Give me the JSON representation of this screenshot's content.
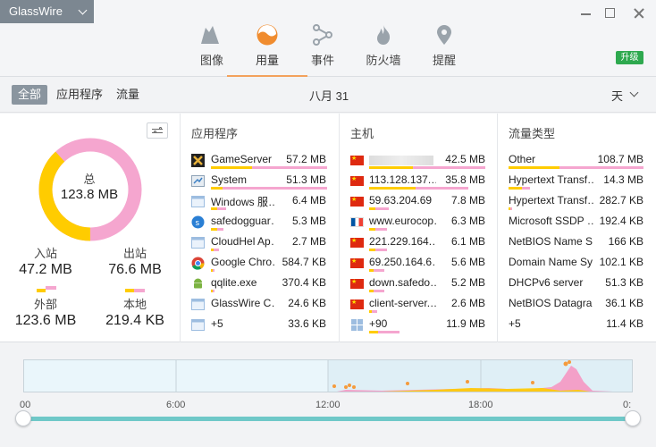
{
  "window": {
    "app_name": "GlassWire"
  },
  "nav": {
    "tabs": [
      {
        "label": "图像"
      },
      {
        "label": "用量"
      },
      {
        "label": "事件"
      },
      {
        "label": "防火墙"
      },
      {
        "label": "提醒"
      }
    ],
    "upgrade_label": "升级"
  },
  "filter": {
    "all": "全部",
    "apps": "应用程序",
    "traffic": "流量",
    "date": "八月 31",
    "period": "天"
  },
  "summary": {
    "total_label": "总",
    "total_value": "123.8 MB",
    "incoming_label": "入站",
    "incoming_value": "47.2 MB",
    "outgoing_label": "出站",
    "outgoing_value": "76.6 MB",
    "external_label": "外部",
    "external_value": "123.6 MB",
    "local_label": "本地",
    "local_value": "219.4 KB",
    "incoming_fraction": 0.381,
    "colors": {
      "incoming": "#ffcc00",
      "outgoing": "#f5a6cf"
    }
  },
  "apps": {
    "title": "应用程序",
    "rows": [
      {
        "name": "GameServer",
        "value": "57.2 MB",
        "icon": "gameserver-icon",
        "in": 0.35,
        "out": 0.65
      },
      {
        "name": "System",
        "value": "51.3 MB",
        "icon": "system-icon",
        "in": 0.1,
        "out": 0.9
      },
      {
        "name": "Windows 服…",
        "value": "6.4 MB",
        "icon": "window-icon",
        "in": 0.05,
        "out": 0.08
      },
      {
        "name": "safedogguar…",
        "value": "5.3 MB",
        "icon": "safedog-icon",
        "in": 0.05,
        "out": 0.06
      },
      {
        "name": "CloudHel Ap…",
        "value": "2.7 MB",
        "icon": "window-icon",
        "in": 0.02,
        "out": 0.05
      },
      {
        "name": "Google Chro…",
        "value": "584.7 KB",
        "icon": "chrome-icon",
        "in": 0.01,
        "out": 0.01
      },
      {
        "name": "qqlite.exe",
        "value": "370.4 KB",
        "icon": "android-icon",
        "in": 0.01,
        "out": 0.01
      },
      {
        "name": "GlassWire C…",
        "value": "24.6 KB",
        "icon": "window-icon",
        "in": 0.0,
        "out": 0.0
      },
      {
        "name": "+5",
        "value": "33.6 KB",
        "icon": "window-icon",
        "in": 0.0,
        "out": 0.0
      }
    ]
  },
  "hosts": {
    "title": "主机",
    "rows": [
      {
        "name": "",
        "value": "42.5 MB",
        "flag": "cn",
        "in": 0.38,
        "out": 0.62
      },
      {
        "name": "113.128.137.…",
        "value": "35.8 MB",
        "flag": "cn",
        "in": 0.4,
        "out": 0.45
      },
      {
        "name": "59.63.204.69",
        "value": "7.8 MB",
        "flag": "cn",
        "in": 0.05,
        "out": 0.12
      },
      {
        "name": "www.eurocop…",
        "value": "6.3 MB",
        "flag": "fr",
        "in": 0.05,
        "out": 0.1
      },
      {
        "name": "221.229.164.…",
        "value": "6.1 MB",
        "flag": "cn",
        "in": 0.05,
        "out": 0.1
      },
      {
        "name": "69.250.164.6…",
        "value": "5.6 MB",
        "flag": "cn",
        "in": 0.04,
        "out": 0.09
      },
      {
        "name": "down.safedo…",
        "value": "5.2 MB",
        "flag": "cn",
        "in": 0.04,
        "out": 0.09
      },
      {
        "name": "client-server.…",
        "value": "2.6 MB",
        "flag": "cn",
        "in": 0.02,
        "out": 0.05
      },
      {
        "name": "+90",
        "value": "11.9 MB",
        "flag": "grid",
        "in": 0.08,
        "out": 0.18
      }
    ]
  },
  "traffic_types": {
    "title": "流量类型",
    "rows": [
      {
        "name": "Other",
        "value": "108.7 MB",
        "in": 0.38,
        "out": 0.62
      },
      {
        "name": "Hypertext Transf…",
        "value": "14.3 MB",
        "in": 0.1,
        "out": 0.06
      },
      {
        "name": "Hypertext Transf…",
        "value": "282.7 KB",
        "in": 0.01,
        "out": 0.01
      },
      {
        "name": "Microsoft SSDP …",
        "value": "192.4 KB",
        "in": 0.0,
        "out": 0.0
      },
      {
        "name": "NetBIOS Name S…",
        "value": "166 KB",
        "in": 0.0,
        "out": 0.0
      },
      {
        "name": "Domain Name Sy…",
        "value": "102.1 KB",
        "in": 0.0,
        "out": 0.0
      },
      {
        "name": "DHCPv6 server",
        "value": "51.3 KB",
        "in": 0.0,
        "out": 0.0
      },
      {
        "name": "NetBIOS Datagra…",
        "value": "36.1 KB",
        "in": 0.0,
        "out": 0.0
      },
      {
        "name": "+5",
        "value": "11.4 KB",
        "in": 0.0,
        "out": 0.0
      }
    ]
  },
  "timeline": {
    "ticks": [
      "00",
      "6:00",
      "12:00",
      "18:00",
      "0:"
    ],
    "colors": {
      "incoming": "#ffcc00",
      "outgoing": "#f3a0c8",
      "event": "#f59b3c"
    }
  }
}
